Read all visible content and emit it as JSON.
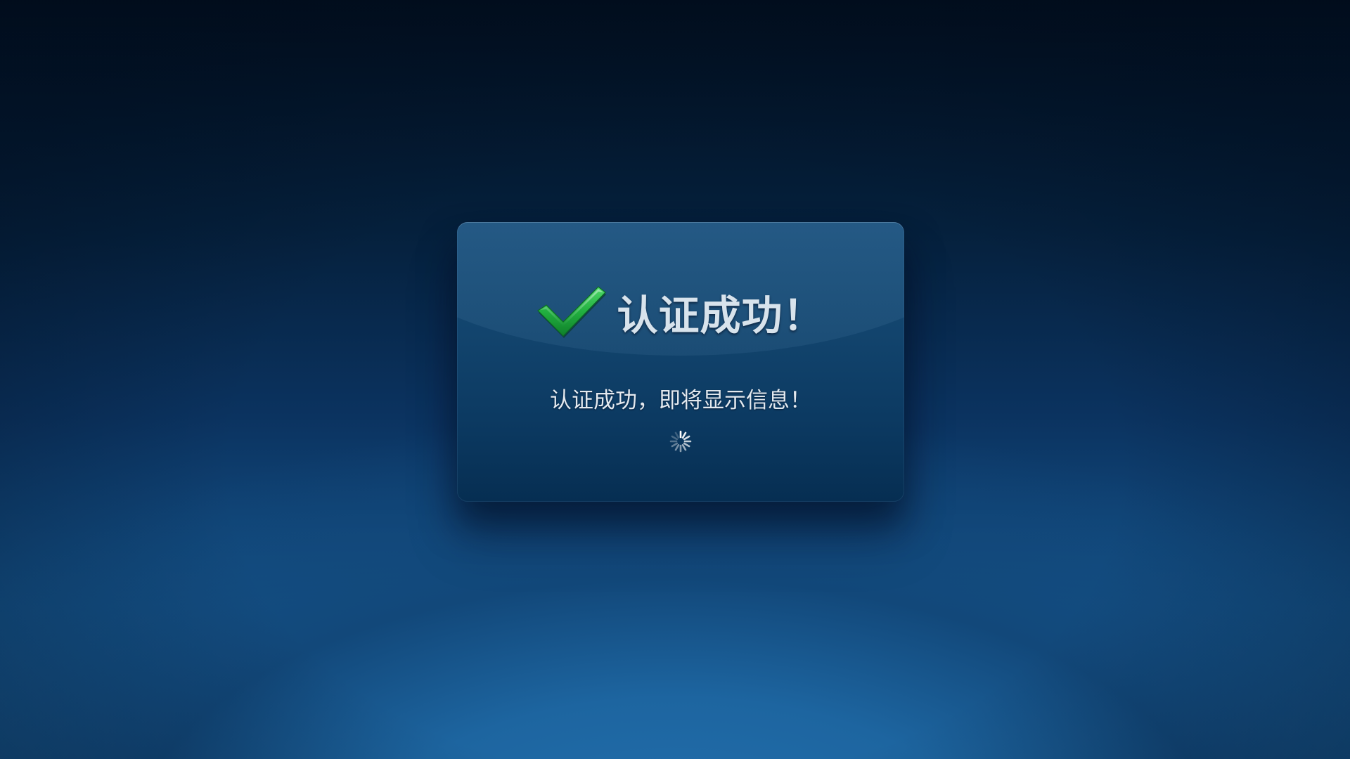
{
  "dialog": {
    "title": "认证成功！",
    "message": "认证成功，即将显示信息！",
    "status_icon": "check-icon",
    "loading_icon": "spinner-icon"
  },
  "colors": {
    "background_top": "#010e1e",
    "background_bottom": "#1f6aa6",
    "dialog_top": "#184e7a",
    "dialog_bottom": "#062e52",
    "check_green": "#1fae3c",
    "text": "#dfe7ee"
  }
}
